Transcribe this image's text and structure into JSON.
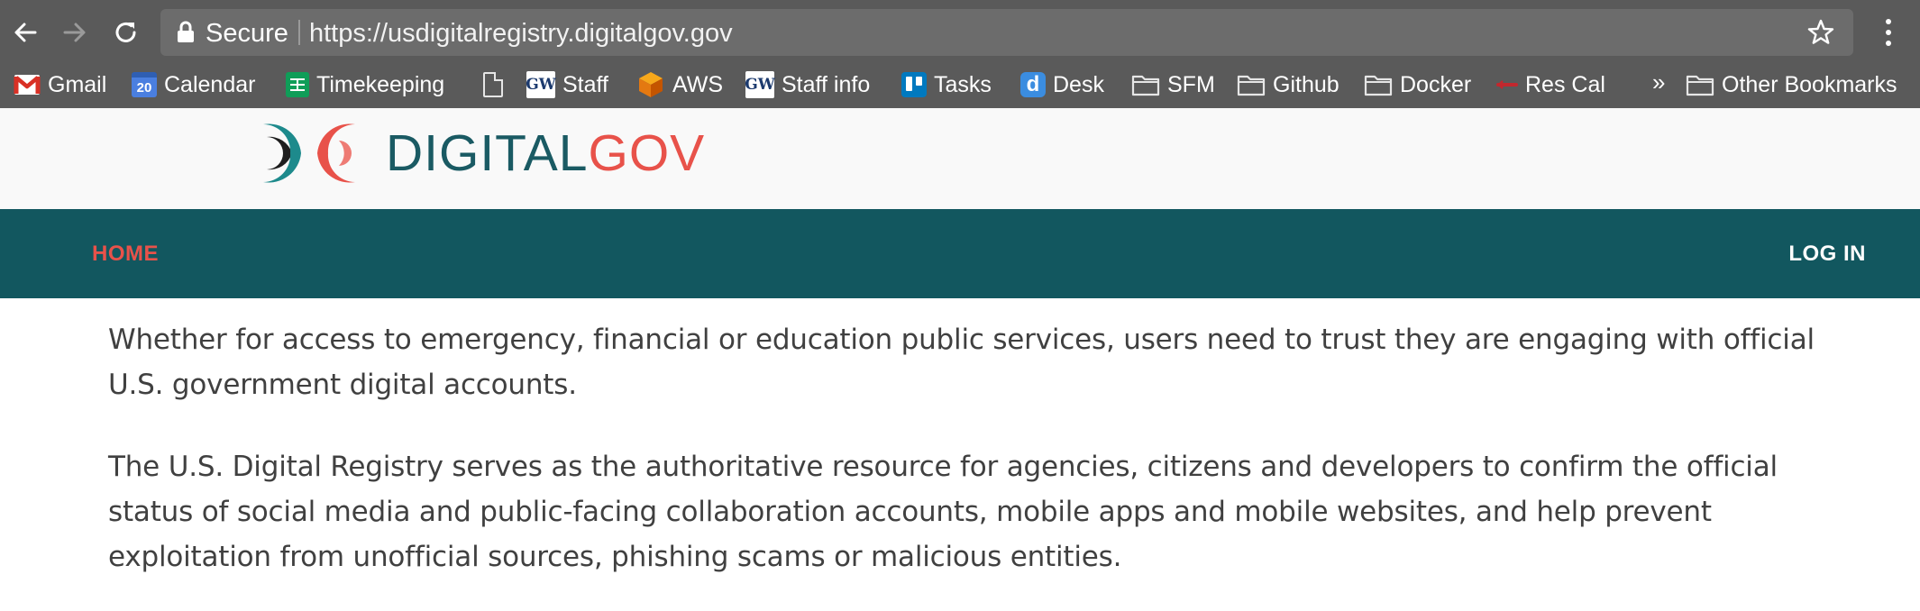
{
  "browser": {
    "security_label": "Secure",
    "url": "https://usdigitalregistry.digitalgov.gov",
    "icons": {
      "back": "back-arrow-icon",
      "forward": "forward-arrow-icon",
      "reload": "reload-icon",
      "lock": "lock-icon",
      "star": "star-icon",
      "menu": "kebab-menu-icon"
    },
    "bookmarks": [
      {
        "label": "Gmail",
        "icon": "gmail-icon"
      },
      {
        "label": "Calendar",
        "icon": "calendar-icon",
        "icon_text": "20"
      },
      {
        "label": "Timekeeping",
        "icon": "sheets-icon"
      },
      {
        "label": "",
        "icon": "page-icon"
      },
      {
        "label": "Staff",
        "icon": "gw-icon",
        "icon_text": "GW"
      },
      {
        "label": "AWS",
        "icon": "aws-icon"
      },
      {
        "label": "Staff info",
        "icon": "gw-icon",
        "icon_text": "GW"
      },
      {
        "label": "Tasks",
        "icon": "trello-icon"
      },
      {
        "label": "Desk",
        "icon": "desk-icon",
        "icon_text": "d"
      },
      {
        "label": "SFM",
        "icon": "folder-icon"
      },
      {
        "label": "Github",
        "icon": "folder-icon"
      },
      {
        "label": "Docker",
        "icon": "folder-icon"
      },
      {
        "label": "Res Cal",
        "icon": "rescal-icon"
      }
    ],
    "overflow_label": "»",
    "other_bookmarks_label": "Other Bookmarks"
  },
  "site": {
    "logo": {
      "text_primary": "DIGITAL",
      "text_accent": "GOV"
    },
    "nav": {
      "home_label": "HOME",
      "login_label": "LOG IN"
    },
    "content": {
      "paragraphs": [
        "Whether for access to emergency, financial or education public services, users need to trust they are engaging with official U.S. government digital accounts.",
        "The U.S. Digital Registry serves as the authoritative resource for agencies, citizens and developers to confirm the official status of social media and public-facing collaboration accounts, mobile apps and mobile websites, and help prevent exploitation from unofficial sources, phishing scams or malicious entities."
      ]
    }
  },
  "colors": {
    "chrome_bg": "#5a5a5a",
    "omnibox_bg": "#6c6c6c",
    "header_bg": "#f9f9f9",
    "nav_bg": "#12575f",
    "accent_red": "#e8524a",
    "logo_teal": "#1a5a63",
    "body_text": "#404040"
  }
}
